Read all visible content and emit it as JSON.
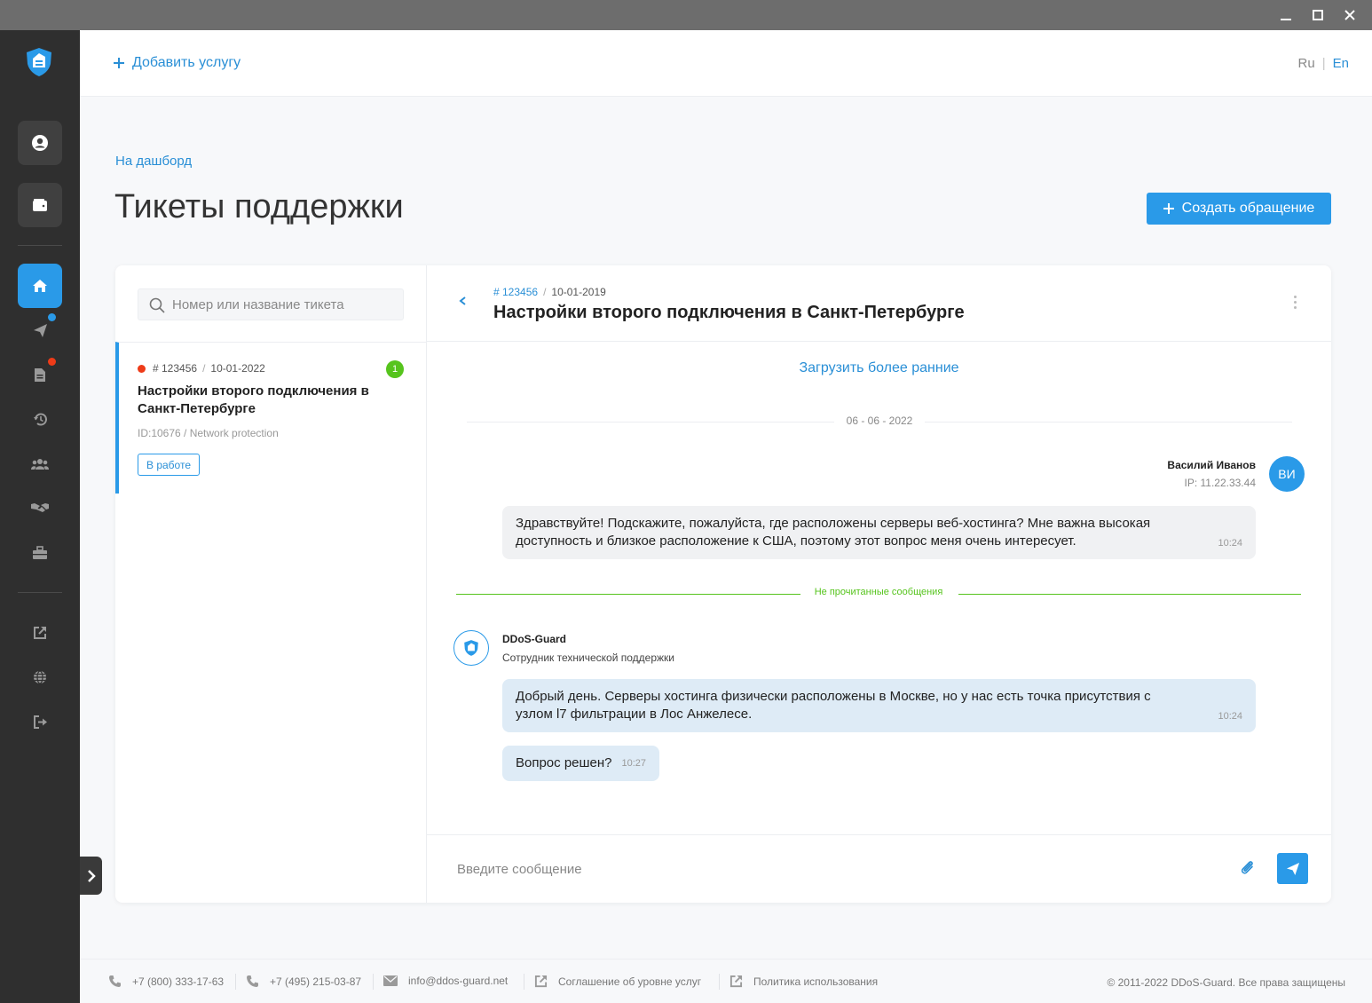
{
  "topbar": {
    "add_service": "Добавить услугу",
    "lang_ru": "Ru",
    "lang_sep": "|",
    "lang_en": "En"
  },
  "breadcrumb": "На дашборд",
  "page_title": "Тикеты поддержки",
  "create_button": "Создать обращение",
  "search": {
    "placeholder": "Номер или название тикета"
  },
  "ticket": {
    "number": "# 123456",
    "date": "10-01-2022",
    "unread_count": "1",
    "title": "Настройки второго подключения в Санкт-Петербурге",
    "id_line": "ID:10676 / Network protection",
    "status": "В работе"
  },
  "chat": {
    "number": "# 123456",
    "date": "10-01-2019",
    "title": "Настройки второго подключения в Санкт-Петербурге",
    "load_earlier": "Загрузить более ранние",
    "date_separator": "06 - 06 - 2022",
    "user": {
      "name": "Василий Иванов",
      "ip": "IP: 11.22.33.44",
      "initials": "ВИ",
      "message_line1": "Здравствуйте! Подскажите, пожалуйста, где расположены серверы веб-хостинга? Мне важна высокая",
      "message_line2": "доступность и близкое расположение к США, поэтому этот вопрос меня очень интересует.",
      "time": "10:24"
    },
    "unread_label": "Не прочитанные сообщения",
    "support": {
      "name": "DDoS-Guard",
      "role": "Сотрудник технической поддержки",
      "message1_line1": "Добрый день. Серверы хостинга физически расположены в Москве, но у нас есть точка присутствия с",
      "message1_line2": "узлом l7 фильтрации в Лос Анжелесе.",
      "message1_time": "10:24",
      "message2": "Вопрос решен?",
      "message2_time": "10:27"
    },
    "composer_placeholder": "Введите сообщение"
  },
  "footer": {
    "phone1": "+7 (800) 333-17-63",
    "phone2": "+7 (495) 215-03-87",
    "email": "info@ddos-guard.net",
    "sla": "Соглашение об уровне услуг",
    "policy": "Политика использования",
    "copyright": "© 2011-2022 DDoS-Guard. Все права защищены"
  },
  "colors": {
    "accent": "#2a9ae8",
    "sidebar": "#2f2f2f",
    "unread_green": "#56c41d",
    "alert_red": "#ee3b18"
  },
  "icons": {
    "sidebar": [
      "user-icon",
      "wallet-icon",
      "home-icon",
      "send-icon",
      "document-icon",
      "history-icon",
      "users-icon",
      "handshake-icon",
      "toolbox-icon",
      "external-link-icon",
      "globe-icon",
      "logout-icon"
    ]
  }
}
